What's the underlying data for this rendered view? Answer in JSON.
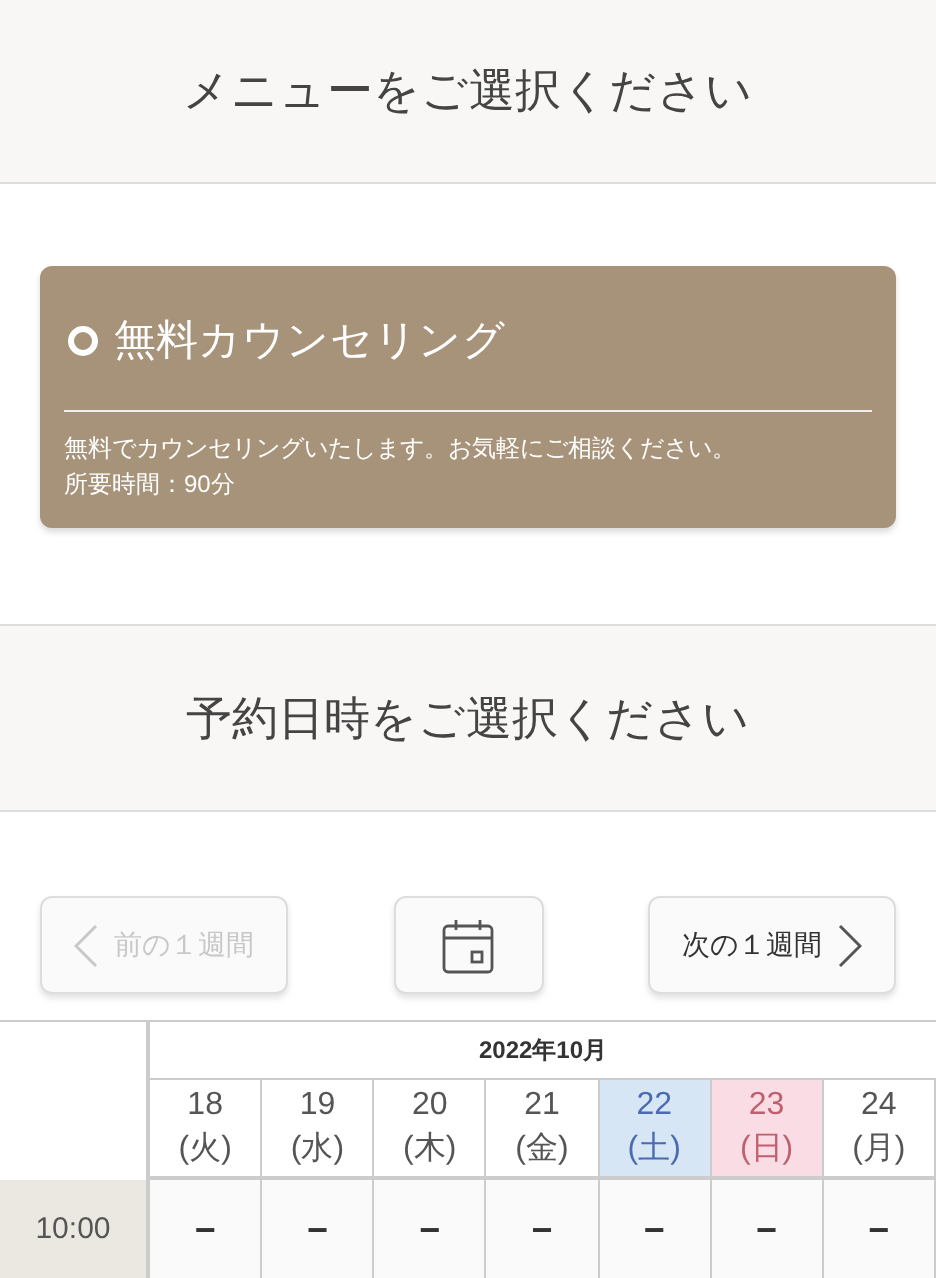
{
  "menu_header": {
    "title": "メニューをご選択ください"
  },
  "menu_items": [
    {
      "title": "無料カウンセリング",
      "description": "無料でカウンセリングいたします。お気軽にご相談ください。",
      "duration": "所要時間：90分"
    }
  ],
  "date_header": {
    "title": "予約日時をご選択ください"
  },
  "nav": {
    "prev": {
      "label": "前の１週間",
      "disabled": true
    },
    "next": {
      "label": "次の１週間",
      "disabled": false
    }
  },
  "calendar": {
    "month": "2022年10月",
    "days": [
      {
        "date": "18",
        "weekday": "(火)",
        "kind": "weekday"
      },
      {
        "date": "19",
        "weekday": "(水)",
        "kind": "weekday"
      },
      {
        "date": "20",
        "weekday": "(木)",
        "kind": "weekday"
      },
      {
        "date": "21",
        "weekday": "(金)",
        "kind": "weekday"
      },
      {
        "date": "22",
        "weekday": "(土)",
        "kind": "saturday"
      },
      {
        "date": "23",
        "weekday": "(日)",
        "kind": "sunday"
      },
      {
        "date": "24",
        "weekday": "(月)",
        "kind": "weekday"
      }
    ],
    "rows": [
      {
        "time": "10:00",
        "slots": [
          "−",
          "−",
          "−",
          "−",
          "−",
          "−",
          "−"
        ]
      }
    ]
  }
}
